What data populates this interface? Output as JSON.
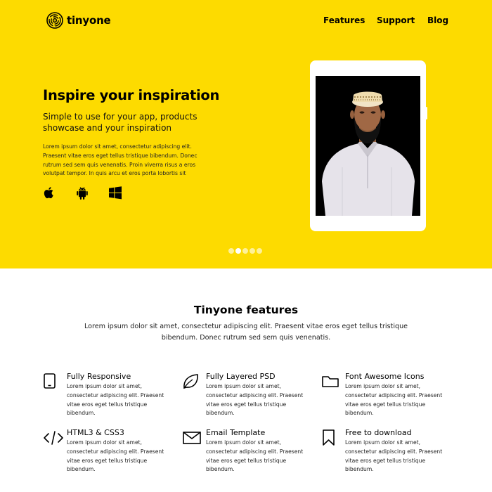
{
  "brand": {
    "name": "tinyone",
    "logo_icon": "fingerprint-icon"
  },
  "nav": {
    "items": [
      "Features",
      "Support",
      "Blog"
    ]
  },
  "hero": {
    "title": "Inspire your inspiration",
    "subtitle": "Simple to use for your app, products showcase and your inspiration",
    "body": "Lorem ipsum dolor sit amet, consectetur adipiscing elit. Praesent vitae eros eget tellus tristique bibendum. Donec rutrum sed sem quis venenatis. Proin viverra risus a eros volutpat tempor. In quis arcu et eros porta lobortis sit",
    "platforms": [
      "apple-icon",
      "android-icon",
      "windows-icon"
    ],
    "accent_color": "#fddb00",
    "slider": {
      "total": 5,
      "active": 2
    }
  },
  "features": {
    "title": "Tinyone features",
    "intro": "Lorem ipsum dolor sit amet, consectetur adipiscing elit. Praesent vitae eros eget tellus tristique bibendum. Donec rutrum sed sem quis venenatis.",
    "items": [
      {
        "icon": "tablet-icon",
        "title": "Fully Responsive",
        "desc": "Lorem ipsum dolor sit amet, consectetur adipiscing elit. Praesent vitae eros eget tellus tristique bibendum."
      },
      {
        "icon": "leaf-icon",
        "title": "Fully Layered PSD",
        "desc": "Lorem ipsum dolor sit amet, consectetur adipiscing elit. Praesent vitae eros eget tellus tristique bibendum."
      },
      {
        "icon": "folder-icon",
        "title": "Font Awesome Icons",
        "desc": "Lorem ipsum dolor sit amet, consectetur adipiscing elit. Praesent vitae eros eget tellus tristique bibendum."
      },
      {
        "icon": "code-icon",
        "title": "HTML3 & CSS3",
        "desc": "Lorem ipsum dolor sit amet, consectetur adipiscing elit. Praesent vitae eros eget tellus tristique bibendum."
      },
      {
        "icon": "envelope-icon",
        "title": "Email Template",
        "desc": "Lorem ipsum dolor sit amet, consectetur adipiscing elit. Praesent vitae eros eget tellus tristique bibendum."
      },
      {
        "icon": "bookmark-icon",
        "title": "Free to download",
        "desc": "Lorem ipsum dolor sit amet, consectetur adipiscing elit. Praesent vitae eros eget tellus tristique bibendum."
      }
    ]
  }
}
